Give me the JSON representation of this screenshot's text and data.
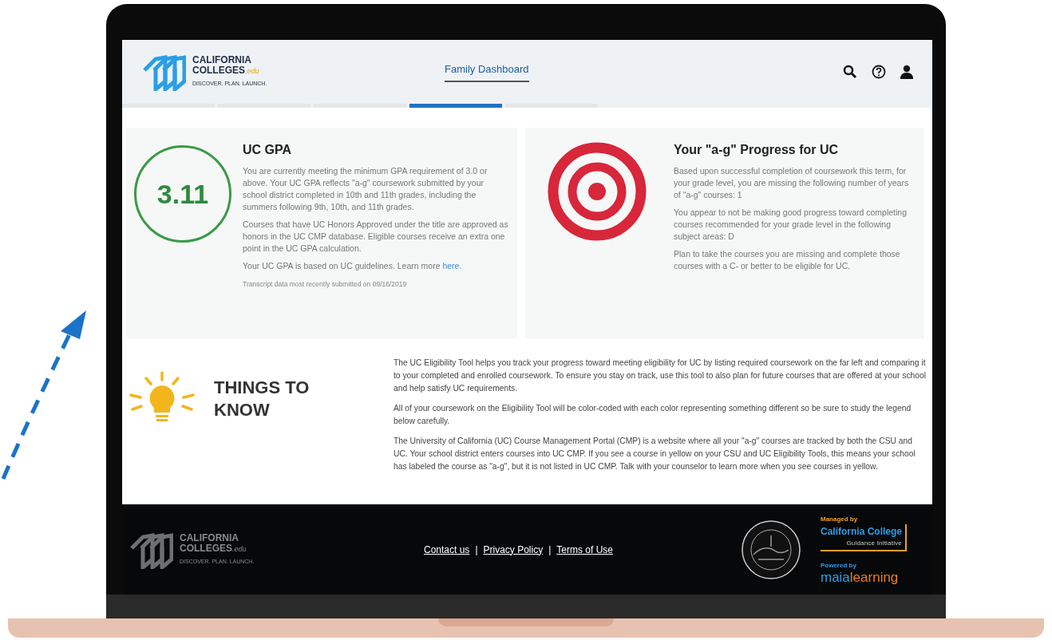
{
  "header": {
    "logo": {
      "line1": "CALIFORNIA",
      "line2": "COLLEGES",
      "suffix": ".edu",
      "tagline": "DISCOVER. PLAN. LAUNCH."
    },
    "nav_link": "Family Dashboard",
    "nav_tabs": [
      {
        "selected": false
      },
      {
        "selected": false
      },
      {
        "selected": false
      },
      {
        "selected": true
      },
      {
        "selected": false
      }
    ]
  },
  "gpa_card": {
    "gpa": "3.11",
    "title": "UC GPA",
    "paragraphs": [
      "You are currently meeting the minimum GPA requirement of 3.0 or above. Your UC GPA reflects \"a-g\" coursework submitted by your school district completed in 10th and 11th grades, including the summers following 9th, 10th, and 11th grades.",
      "Courses that have UC Honors Approved under the title are approved as honors in the UC CMP database. Eligible courses receive an extra one point in the UC GPA calculation."
    ],
    "learn_more": {
      "text": "Your UC GPA is based on UC guidelines. Learn more ",
      "link": "here."
    },
    "note": "Transcript data most recently submitted on 09/16/2019"
  },
  "progress_card": {
    "title": "Your \"a-g\" Progress for UC",
    "paragraphs": [
      "Based upon successful completion of coursework this term, for your grade level, you are missing the following number of years of \"a-g\" courses: 1",
      "You appear to not be making good progress toward completing courses recommended for your grade level in the following subject areas: D",
      "Plan to take the courses you are missing and complete those courses with a C- or better to be eligible for UC."
    ]
  },
  "things_to_know": {
    "title_lines": [
      "THINGS TO",
      "KNOW"
    ],
    "paragraphs": [
      "The UC Eligibility Tool helps you track your progress toward meeting eligibility for UC by listing required coursework on the far left and comparing it to your completed and enrolled coursework. To ensure you stay on track, use this tool to also plan for future courses that are offered at your school and help satisfy UC requirements.",
      "All of your coursework on the Eligibility Tool will be color-coded with each color representing something different so be sure to study the legend below carefully.",
      "The University of California (UC) Course Management Portal (CMP) is a website where all your \"a-g\" courses are tracked by both the CSU and UC. Your school district enters courses into UC CMP. If you see a course in yellow on your CSU and UC Eligibility Tools, this means your school has labeled the course as \"a-g\", but it is not listed in UC CMP. Talk with your counselor to learn more when you see courses in yellow."
    ]
  },
  "footer": {
    "logo": {
      "line1": "CALIFORNIA",
      "line2": "COLLEGES",
      "suffix": ".edu",
      "tagline": "DISCOVER. PLAN. LAUNCH."
    },
    "links": [
      "Contact us",
      "Privacy Policy",
      "Terms of Use"
    ],
    "separator": "|",
    "managed_by": {
      "label": "Managed by",
      "name": "California College",
      "sub": "Guidance Initiative"
    },
    "powered_by": {
      "label": "Powered by",
      "name_part1": "maia",
      "name_part2": "learning"
    }
  }
}
